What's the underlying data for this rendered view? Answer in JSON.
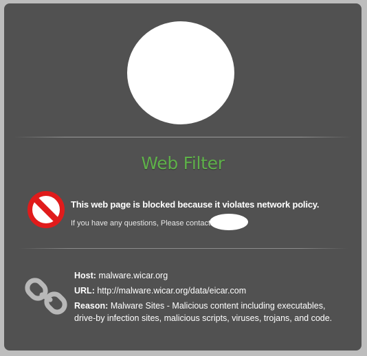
{
  "page": {
    "title": "Web Filter",
    "block_message": "This web page is blocked because it violates network policy.",
    "contact_text": "If you have any questions, Please contact"
  },
  "details": {
    "host_label": "Host:",
    "host_value": "malware.wicar.org",
    "url_label": "URL:",
    "url_value": "http://malware.wicar.org/data/eicar.com",
    "reason_label": "Reason:",
    "reason_value": "Malware Sites - Malicious content including executables, drive-by infection sites, malicious scripts, viruses, trojans, and code."
  },
  "icons": {
    "block": "prohibited-icon",
    "link": "broken-link-icon"
  },
  "colors": {
    "background": "#515151",
    "title": "#5fb14a",
    "block_icon": "#e01b1b",
    "link_icon": "#b8b8b8"
  }
}
